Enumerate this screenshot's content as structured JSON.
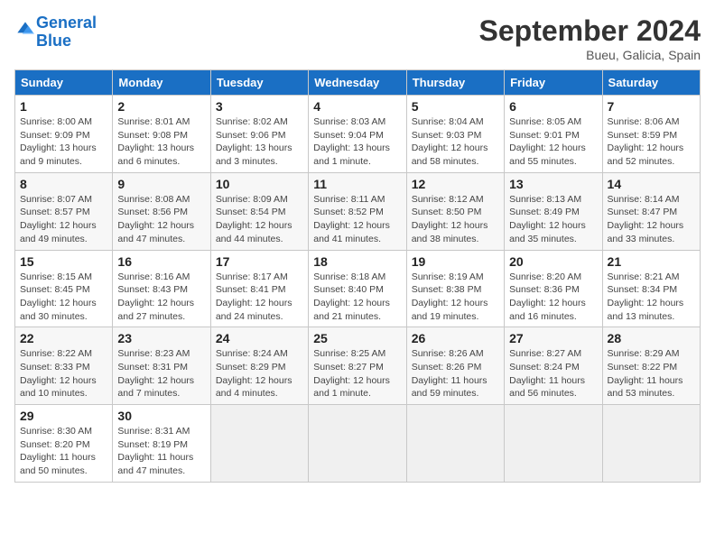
{
  "header": {
    "logo_text_general": "General",
    "logo_text_blue": "Blue",
    "title": "September 2024",
    "subtitle": "Bueu, Galicia, Spain"
  },
  "weekdays": [
    "Sunday",
    "Monday",
    "Tuesday",
    "Wednesday",
    "Thursday",
    "Friday",
    "Saturday"
  ],
  "weeks": [
    [
      {
        "day": "1",
        "info": "Sunrise: 8:00 AM\nSunset: 9:09 PM\nDaylight: 13 hours and 9 minutes."
      },
      {
        "day": "2",
        "info": "Sunrise: 8:01 AM\nSunset: 9:08 PM\nDaylight: 13 hours and 6 minutes."
      },
      {
        "day": "3",
        "info": "Sunrise: 8:02 AM\nSunset: 9:06 PM\nDaylight: 13 hours and 3 minutes."
      },
      {
        "day": "4",
        "info": "Sunrise: 8:03 AM\nSunset: 9:04 PM\nDaylight: 13 hours and 1 minute."
      },
      {
        "day": "5",
        "info": "Sunrise: 8:04 AM\nSunset: 9:03 PM\nDaylight: 12 hours and 58 minutes."
      },
      {
        "day": "6",
        "info": "Sunrise: 8:05 AM\nSunset: 9:01 PM\nDaylight: 12 hours and 55 minutes."
      },
      {
        "day": "7",
        "info": "Sunrise: 8:06 AM\nSunset: 8:59 PM\nDaylight: 12 hours and 52 minutes."
      }
    ],
    [
      {
        "day": "8",
        "info": "Sunrise: 8:07 AM\nSunset: 8:57 PM\nDaylight: 12 hours and 49 minutes."
      },
      {
        "day": "9",
        "info": "Sunrise: 8:08 AM\nSunset: 8:56 PM\nDaylight: 12 hours and 47 minutes."
      },
      {
        "day": "10",
        "info": "Sunrise: 8:09 AM\nSunset: 8:54 PM\nDaylight: 12 hours and 44 minutes."
      },
      {
        "day": "11",
        "info": "Sunrise: 8:11 AM\nSunset: 8:52 PM\nDaylight: 12 hours and 41 minutes."
      },
      {
        "day": "12",
        "info": "Sunrise: 8:12 AM\nSunset: 8:50 PM\nDaylight: 12 hours and 38 minutes."
      },
      {
        "day": "13",
        "info": "Sunrise: 8:13 AM\nSunset: 8:49 PM\nDaylight: 12 hours and 35 minutes."
      },
      {
        "day": "14",
        "info": "Sunrise: 8:14 AM\nSunset: 8:47 PM\nDaylight: 12 hours and 33 minutes."
      }
    ],
    [
      {
        "day": "15",
        "info": "Sunrise: 8:15 AM\nSunset: 8:45 PM\nDaylight: 12 hours and 30 minutes."
      },
      {
        "day": "16",
        "info": "Sunrise: 8:16 AM\nSunset: 8:43 PM\nDaylight: 12 hours and 27 minutes."
      },
      {
        "day": "17",
        "info": "Sunrise: 8:17 AM\nSunset: 8:41 PM\nDaylight: 12 hours and 24 minutes."
      },
      {
        "day": "18",
        "info": "Sunrise: 8:18 AM\nSunset: 8:40 PM\nDaylight: 12 hours and 21 minutes."
      },
      {
        "day": "19",
        "info": "Sunrise: 8:19 AM\nSunset: 8:38 PM\nDaylight: 12 hours and 19 minutes."
      },
      {
        "day": "20",
        "info": "Sunrise: 8:20 AM\nSunset: 8:36 PM\nDaylight: 12 hours and 16 minutes."
      },
      {
        "day": "21",
        "info": "Sunrise: 8:21 AM\nSunset: 8:34 PM\nDaylight: 12 hours and 13 minutes."
      }
    ],
    [
      {
        "day": "22",
        "info": "Sunrise: 8:22 AM\nSunset: 8:33 PM\nDaylight: 12 hours and 10 minutes."
      },
      {
        "day": "23",
        "info": "Sunrise: 8:23 AM\nSunset: 8:31 PM\nDaylight: 12 hours and 7 minutes."
      },
      {
        "day": "24",
        "info": "Sunrise: 8:24 AM\nSunset: 8:29 PM\nDaylight: 12 hours and 4 minutes."
      },
      {
        "day": "25",
        "info": "Sunrise: 8:25 AM\nSunset: 8:27 PM\nDaylight: 12 hours and 1 minute."
      },
      {
        "day": "26",
        "info": "Sunrise: 8:26 AM\nSunset: 8:26 PM\nDaylight: 11 hours and 59 minutes."
      },
      {
        "day": "27",
        "info": "Sunrise: 8:27 AM\nSunset: 8:24 PM\nDaylight: 11 hours and 56 minutes."
      },
      {
        "day": "28",
        "info": "Sunrise: 8:29 AM\nSunset: 8:22 PM\nDaylight: 11 hours and 53 minutes."
      }
    ],
    [
      {
        "day": "29",
        "info": "Sunrise: 8:30 AM\nSunset: 8:20 PM\nDaylight: 11 hours and 50 minutes."
      },
      {
        "day": "30",
        "info": "Sunrise: 8:31 AM\nSunset: 8:19 PM\nDaylight: 11 hours and 47 minutes."
      },
      null,
      null,
      null,
      null,
      null
    ]
  ]
}
